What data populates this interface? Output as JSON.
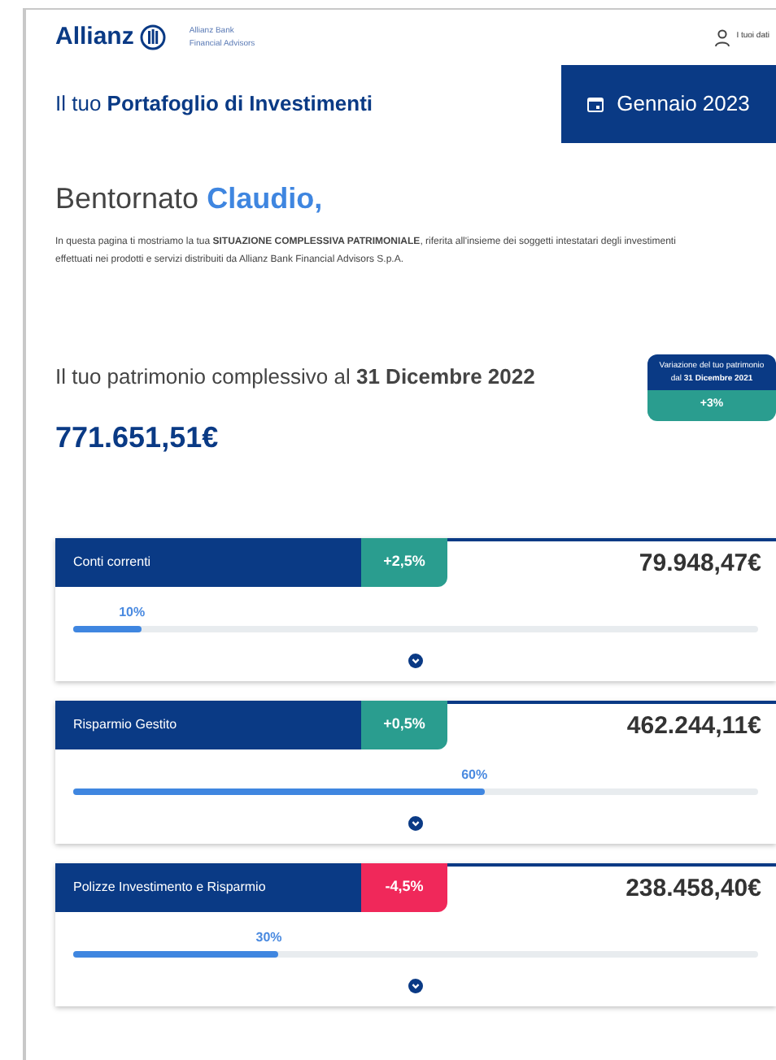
{
  "header": {
    "logo": "Allianz",
    "brand_line_1": "Allianz Bank",
    "brand_line_2": "Financial Advisors",
    "account_link": "I tuoi dati"
  },
  "title": "Il tuo **Portafoglio di Investimenti**",
  "period": "Gennaio 2023",
  "greeting": "Bentornato",
  "name": "Claudio,",
  "intro": "In questa pagina ti mostriamo la tua **SITUAZIONE COMPLESSIVA PATRIMONIALE**, riferita all'insieme dei soggetti intestatari degli investimenti effettuati nei prodotti e servizi distribuiti da Allianz Bank Financial Advisors S.p.A.",
  "total": {
    "heading": "Il tuo patrimonio complessivo al **31 Dicembre 2022**",
    "amount": "771.651,51€",
    "variation_label": "Variazione del tuo patrimonio dal **31 Dicembre 2021**",
    "variation": "+3%"
  },
  "categories": [
    {
      "name": "Conti correnti",
      "change": "+2,5%",
      "color": "#2a9d8f",
      "amount": "79.948,47€",
      "share": "10%",
      "level": 0.1
    },
    {
      "name": "Risparmio Gestito",
      "change": "+0,5%",
      "color": "#2a9d8f",
      "amount": "462.244,11€",
      "share": "60%",
      "level": 0.6
    },
    {
      "name": "Polizze Investimento e Risparmio",
      "change": "-4,5%",
      "color": "#f0285a",
      "amount": "238.458,40€",
      "share": "30%",
      "level": 0.3
    }
  ]
}
